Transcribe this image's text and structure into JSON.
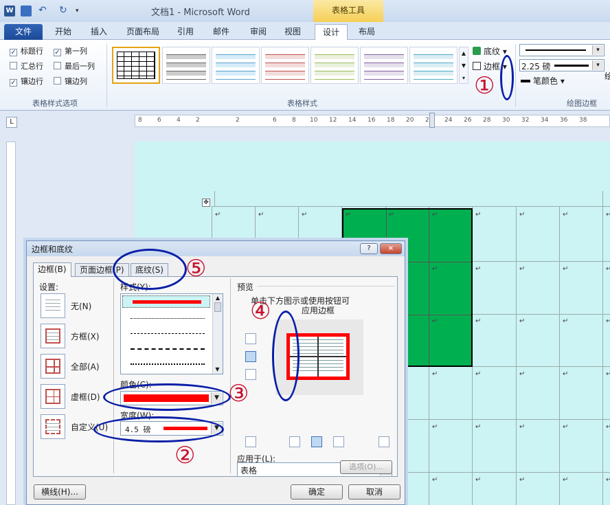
{
  "window": {
    "title": "文档1 - Microsoft Word",
    "context_tab_group": "表格工具"
  },
  "tabs": [
    "文件",
    "开始",
    "插入",
    "页面布局",
    "引用",
    "邮件",
    "审阅",
    "视图",
    "设计",
    "布局"
  ],
  "ribbon": {
    "style_options": {
      "checkboxes": [
        {
          "label": "标题行",
          "checked": true
        },
        {
          "label": "第一列",
          "checked": true
        },
        {
          "label": "汇总行",
          "checked": false
        },
        {
          "label": "最后一列",
          "checked": false
        },
        {
          "label": "镶边行",
          "checked": true
        },
        {
          "label": "镶边列",
          "checked": false
        }
      ],
      "group_label": "表格样式选项"
    },
    "table_styles": {
      "group_label": "表格样式"
    },
    "shading_label": "底纹",
    "borders_label": "边框",
    "draw_borders": {
      "line_weight": "2.25 磅",
      "pen_color_label": "笔颜色",
      "group_label": "绘图边框",
      "cutoff_label": "绘"
    }
  },
  "ruler": {
    "ticks": [
      "8",
      "6",
      "4",
      "2",
      "2",
      "6",
      "8",
      "10",
      "12",
      "14",
      "16",
      "18",
      "20",
      "22",
      "24",
      "26",
      "28",
      "30",
      "32",
      "34",
      "36",
      "38"
    ]
  },
  "dialog": {
    "title": "边框和底纹",
    "help": "?",
    "close": "×",
    "tabs": [
      "边框(B)",
      "页面边框(P)",
      "底纹(S)"
    ],
    "settings_label": "设置:",
    "settings": [
      "无(N)",
      "方框(X)",
      "全部(A)",
      "虚框(D)",
      "自定义(U)"
    ],
    "style_label": "样式(Y):",
    "color_label": "颜色(C):",
    "color_value": "#ff0000",
    "width_label": "宽度(W):",
    "width_value": "4.5 磅",
    "preview_label": "预览",
    "preview_hint_1": "单击下方图示或使用按钮可",
    "preview_hint_2": "应用边框",
    "apply_to_label": "应用于(L):",
    "apply_to_value": "表格",
    "options_button": "选项(O)...",
    "horizontal_line_button": "横线(H)...",
    "ok_button": "确定",
    "cancel_button": "取消"
  },
  "annotations": [
    "①",
    "②",
    "③",
    "④",
    "⑤"
  ],
  "colors": {
    "page": "#cdf4f4",
    "selected_cells": "#00b050",
    "annotation_oval": "#0a1ea8",
    "annotation_number": "#c8102e"
  }
}
